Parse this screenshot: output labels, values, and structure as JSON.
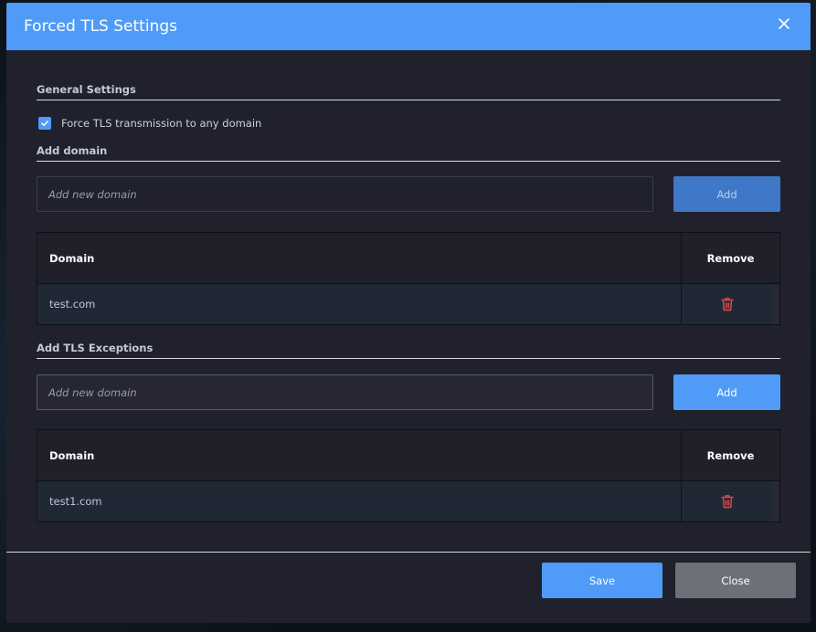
{
  "dialog": {
    "title": "Forced TLS Settings"
  },
  "general": {
    "section_title": "General Settings",
    "force_tls_label": "Force TLS transmission to any domain",
    "force_tls_checked": true
  },
  "add_domain": {
    "section_title": "Add domain",
    "placeholder": "Add new domain",
    "add_label": "Add",
    "table": {
      "col_domain": "Domain",
      "col_remove": "Remove",
      "rows": [
        "test.com"
      ]
    }
  },
  "exceptions": {
    "section_title": "Add TLS Exceptions",
    "placeholder": "Add new domain",
    "add_label": "Add",
    "table": {
      "col_domain": "Domain",
      "col_remove": "Remove",
      "rows": [
        "test1.com"
      ]
    }
  },
  "footer": {
    "save_label": "Save",
    "close_label": "Close"
  },
  "icons": {
    "close": "close-icon",
    "check": "check-icon",
    "trash": "trash-icon"
  },
  "colors": {
    "accent": "#4f9bf7",
    "danger": "#e5484d"
  }
}
